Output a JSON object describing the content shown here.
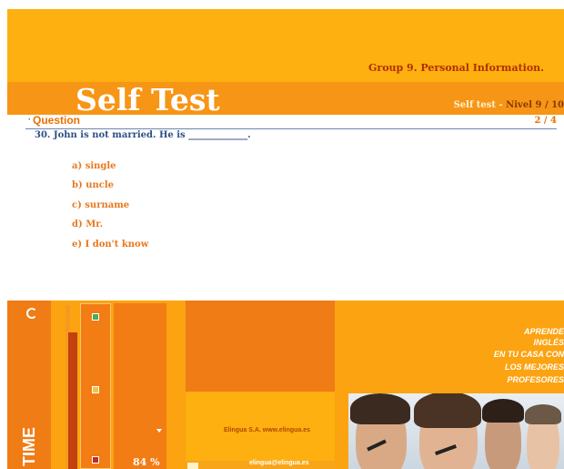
{
  "header": {
    "group_title": "Group 9. Personal Information.",
    "title": "Self Test",
    "level_prefix": "Self test",
    "level_separator": " - ",
    "level": "Nivel 9 / 10"
  },
  "question": {
    "heading": "Question",
    "page": "2 / 4",
    "text": "30. John is not married. He is _____________.",
    "options": [
      "a) single",
      "b) uncle",
      "c) surname",
      "d) Mr.",
      "e) I don't know"
    ]
  },
  "footer": {
    "time_label": "TIME",
    "progress_percent": "84 %",
    "progress_value": 84,
    "company": "Elingua S.A.  www.elingua.es",
    "email": "elingua@elingua.es",
    "promo_lines": [
      "APRENDE",
      "INGLÉS",
      "EN TU CASA CON",
      "LOS MEJORES",
      "PROFESORES"
    ]
  },
  "colors": {
    "header_yellow": "#fdb00f",
    "header_orange": "#f79516",
    "question_blue": "#2d4f87",
    "option_orange": "#e8781e"
  }
}
